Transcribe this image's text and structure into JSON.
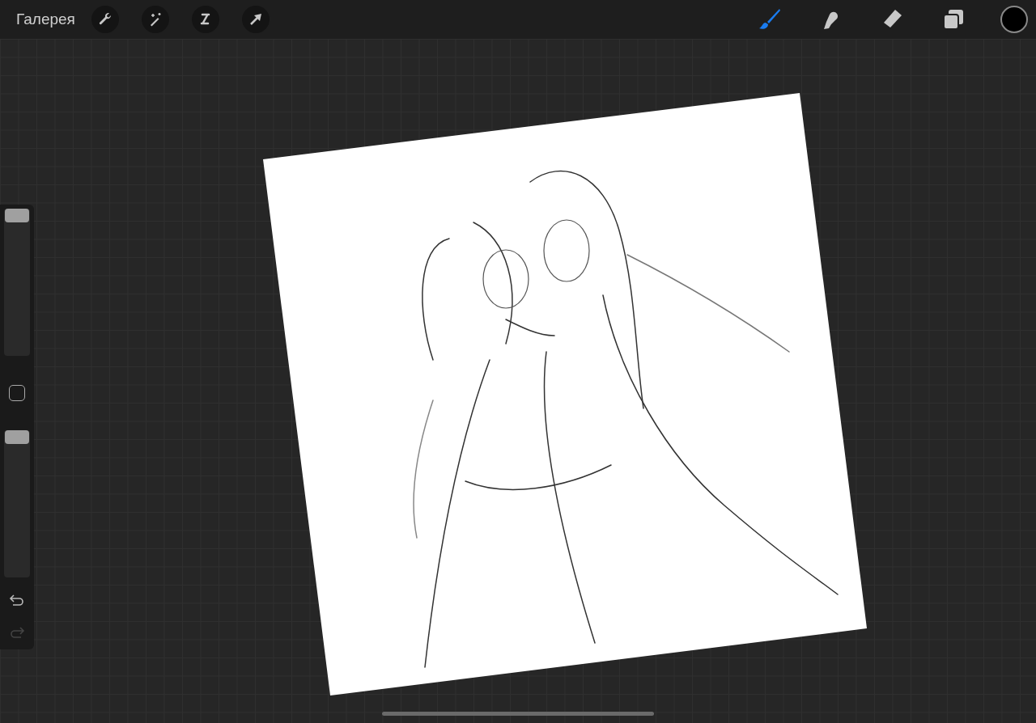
{
  "top_bar": {
    "gallery": "Галерея",
    "actions": [
      {
        "kind": "wrench"
      },
      {
        "kind": "wand"
      },
      {
        "kind": "selection"
      },
      {
        "kind": "transform"
      }
    ],
    "tools": [
      {
        "kind": "brush",
        "selected": true
      },
      {
        "kind": "smudge",
        "selected": false
      },
      {
        "kind": "eraser",
        "selected": false
      },
      {
        "kind": "layers",
        "selected": false
      }
    ],
    "color_swatch": {
      "color": "#000000"
    }
  },
  "sidebar": {
    "sliders": [
      {
        "level": 1
      },
      {
        "level": 1
      }
    ],
    "undo": {
      "disabled": false
    },
    "redo": {
      "disabled": true
    }
  }
}
